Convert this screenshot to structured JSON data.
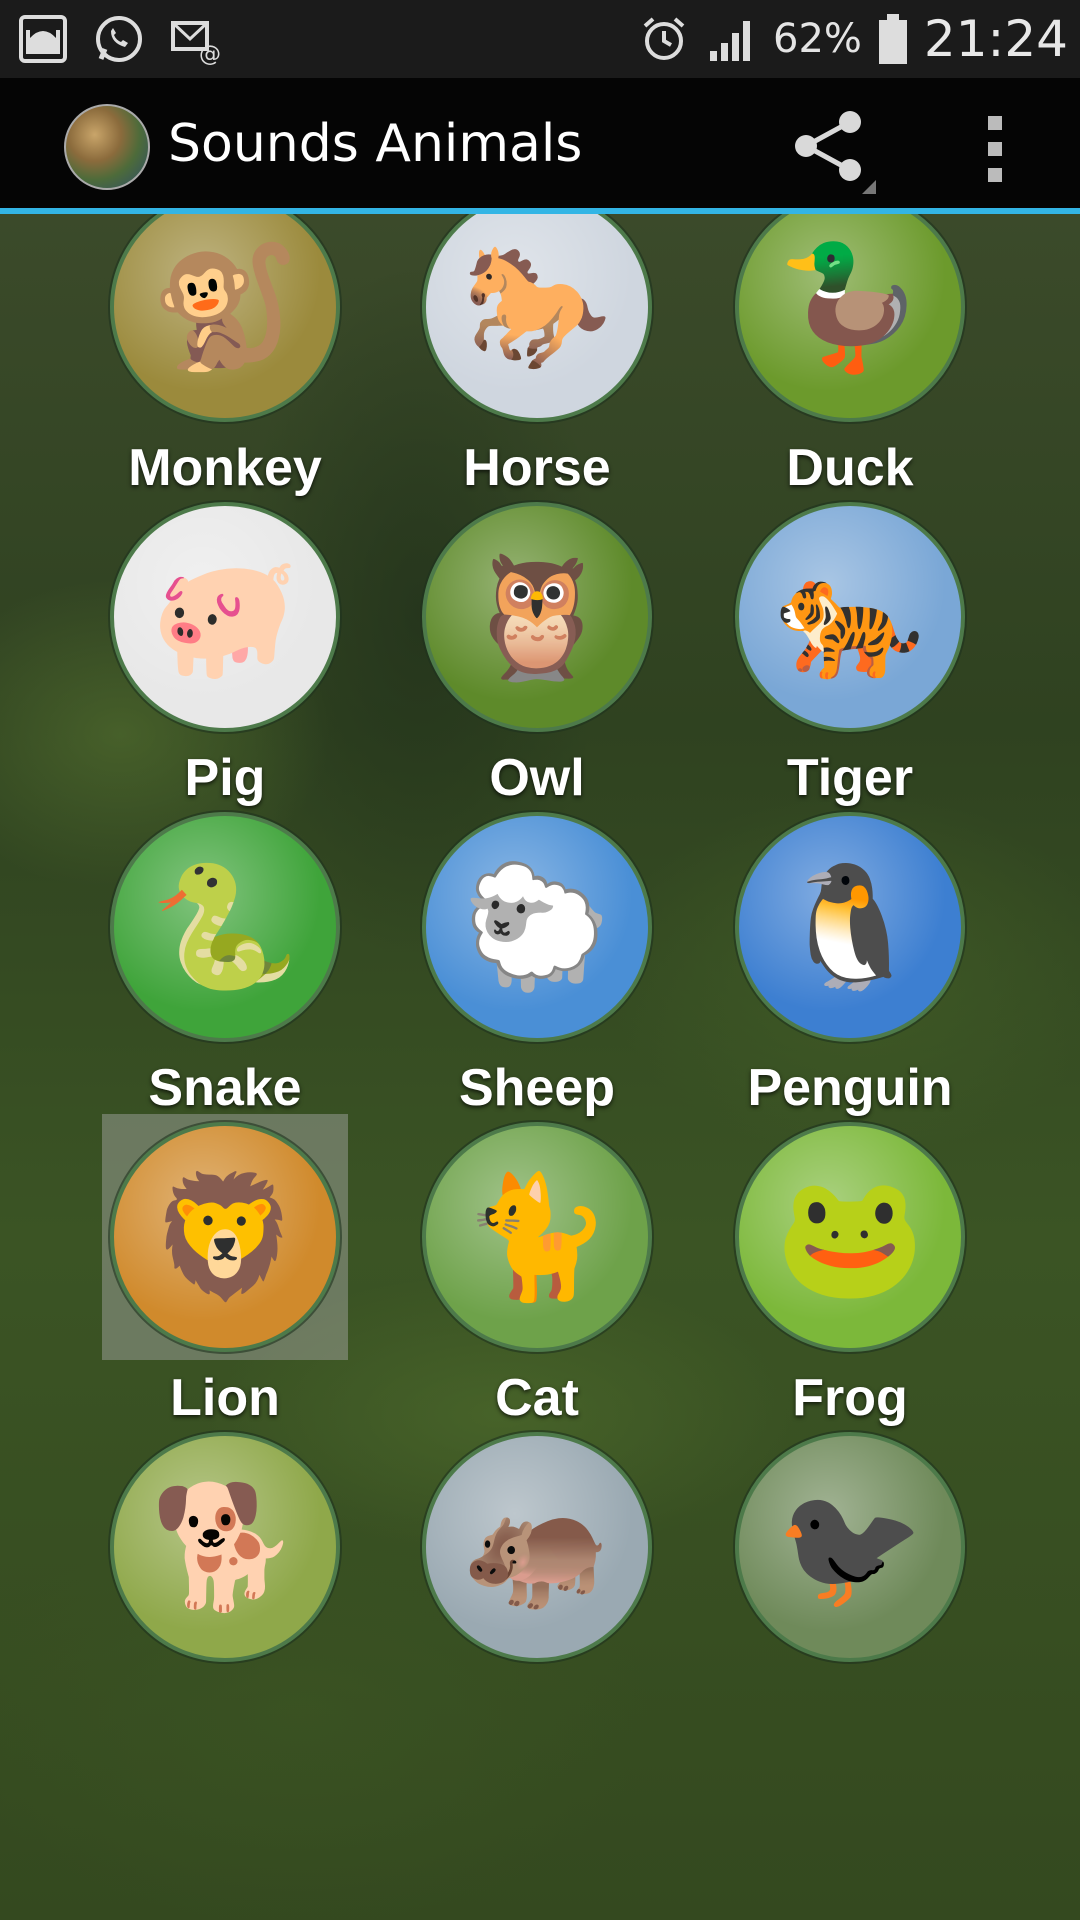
{
  "status_bar": {
    "icons_left": [
      "mosque-icon",
      "whatsapp-icon",
      "email-notification-icon"
    ],
    "alarm_icon": "alarm-clock-icon",
    "signal_icon": "signal-bars-icon",
    "battery_percent": "62%",
    "battery_icon": "battery-icon",
    "time": "21:24"
  },
  "action_bar": {
    "title": "Sounds Animals",
    "share_icon": "share-icon",
    "overflow_icon": "overflow-menu-icon",
    "accent_color": "#33b5e5"
  },
  "animals": [
    {
      "label": "Monkey",
      "icon": "🐒",
      "bg": "#9b8a3c"
    },
    {
      "label": "Horse",
      "icon": "🐎",
      "bg": "#cfd6df"
    },
    {
      "label": "Duck",
      "icon": "🦆",
      "bg": "#6c9a2c"
    },
    {
      "label": "Pig",
      "icon": "🐖",
      "bg": "#e8e8e8"
    },
    {
      "label": "Owl",
      "icon": "🦉",
      "bg": "#5e8a2a"
    },
    {
      "label": "Tiger",
      "icon": "🐅",
      "bg": "#7aa7d6"
    },
    {
      "label": "Snake",
      "icon": "🐍",
      "bg": "#3fa43a"
    },
    {
      "label": "Sheep",
      "icon": "🐑",
      "bg": "#4a8fd6"
    },
    {
      "label": "Penguin",
      "icon": "🐧",
      "bg": "#3d7fd1"
    },
    {
      "label": "Lion",
      "icon": "🦁",
      "bg": "#d08a2c"
    },
    {
      "label": "Cat",
      "icon": "🐈",
      "bg": "#6ea24a"
    },
    {
      "label": "Frog",
      "icon": "🐸",
      "bg": "#7cb83a"
    },
    {
      "label": "",
      "icon": "🐕",
      "bg": "#8fa84a"
    },
    {
      "label": "",
      "icon": "🦛",
      "bg": "#9aa9b2"
    },
    {
      "label": "",
      "icon": "🐦‍⬛",
      "bg": "#6f8a5a"
    }
  ],
  "pressed_item": "Lion"
}
